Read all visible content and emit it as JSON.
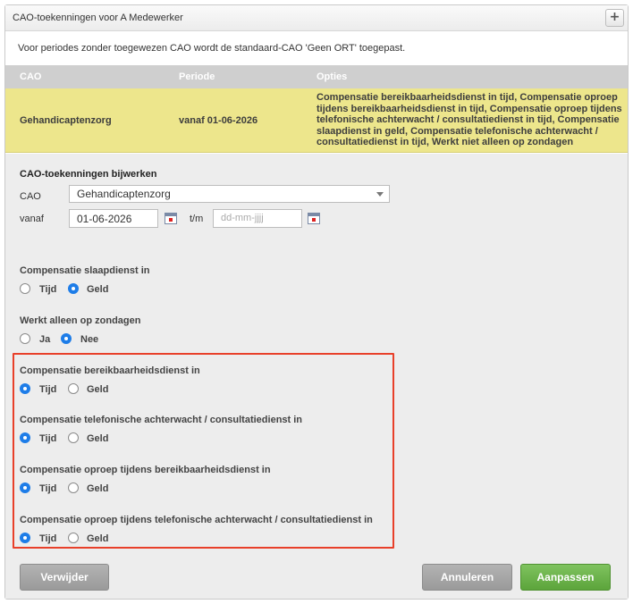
{
  "panel": {
    "title": "CAO-toekenningen voor A Medewerker",
    "add_button": "+",
    "info": "Voor periodes zonder toegewezen CAO wordt de standaard-CAO 'Geen ORT' toegepast."
  },
  "table": {
    "headers": [
      "CAO",
      "Periode",
      "Opties"
    ],
    "rows": [
      {
        "cao": "Gehandicaptenzorg",
        "periode": "vanaf 01-06-2026",
        "opties": "Compensatie bereikbaarheidsdienst in tijd, Compensatie oproep tijdens bereikbaarheidsdienst in tijd, Compensatie oproep tijdens telefonische achterwacht / consultatiedienst in tijd, Compensatie slaapdienst in geld, Compensatie telefonische achterwacht / consultatiedienst in tijd, Werkt niet alleen op zondagen"
      }
    ]
  },
  "form": {
    "title": "CAO-toekenningen bijwerken",
    "cao_label": "CAO",
    "cao_value": "Gehandicaptenzorg",
    "vanaf_label": "vanaf",
    "vanaf_value": "01-06-2026",
    "tm_label": "t/m",
    "tm_placeholder": "dd-mm-jjjj",
    "groups": [
      {
        "title": "Compensatie slaapdienst in",
        "options": [
          "Tijd",
          "Geld"
        ],
        "selected": "Geld"
      },
      {
        "title": "Werkt alleen op zondagen",
        "options": [
          "Ja",
          "Nee"
        ],
        "selected": "Nee"
      },
      {
        "title": "Compensatie bereikbaarheidsdienst in",
        "options": [
          "Tijd",
          "Geld"
        ],
        "selected": "Tijd"
      },
      {
        "title": "Compensatie telefonische achterwacht / consultatiedienst in",
        "options": [
          "Tijd",
          "Geld"
        ],
        "selected": "Tijd"
      },
      {
        "title": "Compensatie oproep tijdens bereikbaarheidsdienst in",
        "options": [
          "Tijd",
          "Geld"
        ],
        "selected": "Tijd"
      },
      {
        "title": "Compensatie oproep tijdens telefonische achterwacht / consultatiedienst in",
        "options": [
          "Tijd",
          "Geld"
        ],
        "selected": "Tijd"
      }
    ]
  },
  "buttons": {
    "delete": "Verwijder",
    "cancel": "Annuleren",
    "save": "Aanpassen"
  },
  "colors": {
    "highlight_row": "#ede68c",
    "primary_button": "#5ca43b",
    "radio_selected": "#1e7de8",
    "annotation_box": "#e8402a"
  }
}
